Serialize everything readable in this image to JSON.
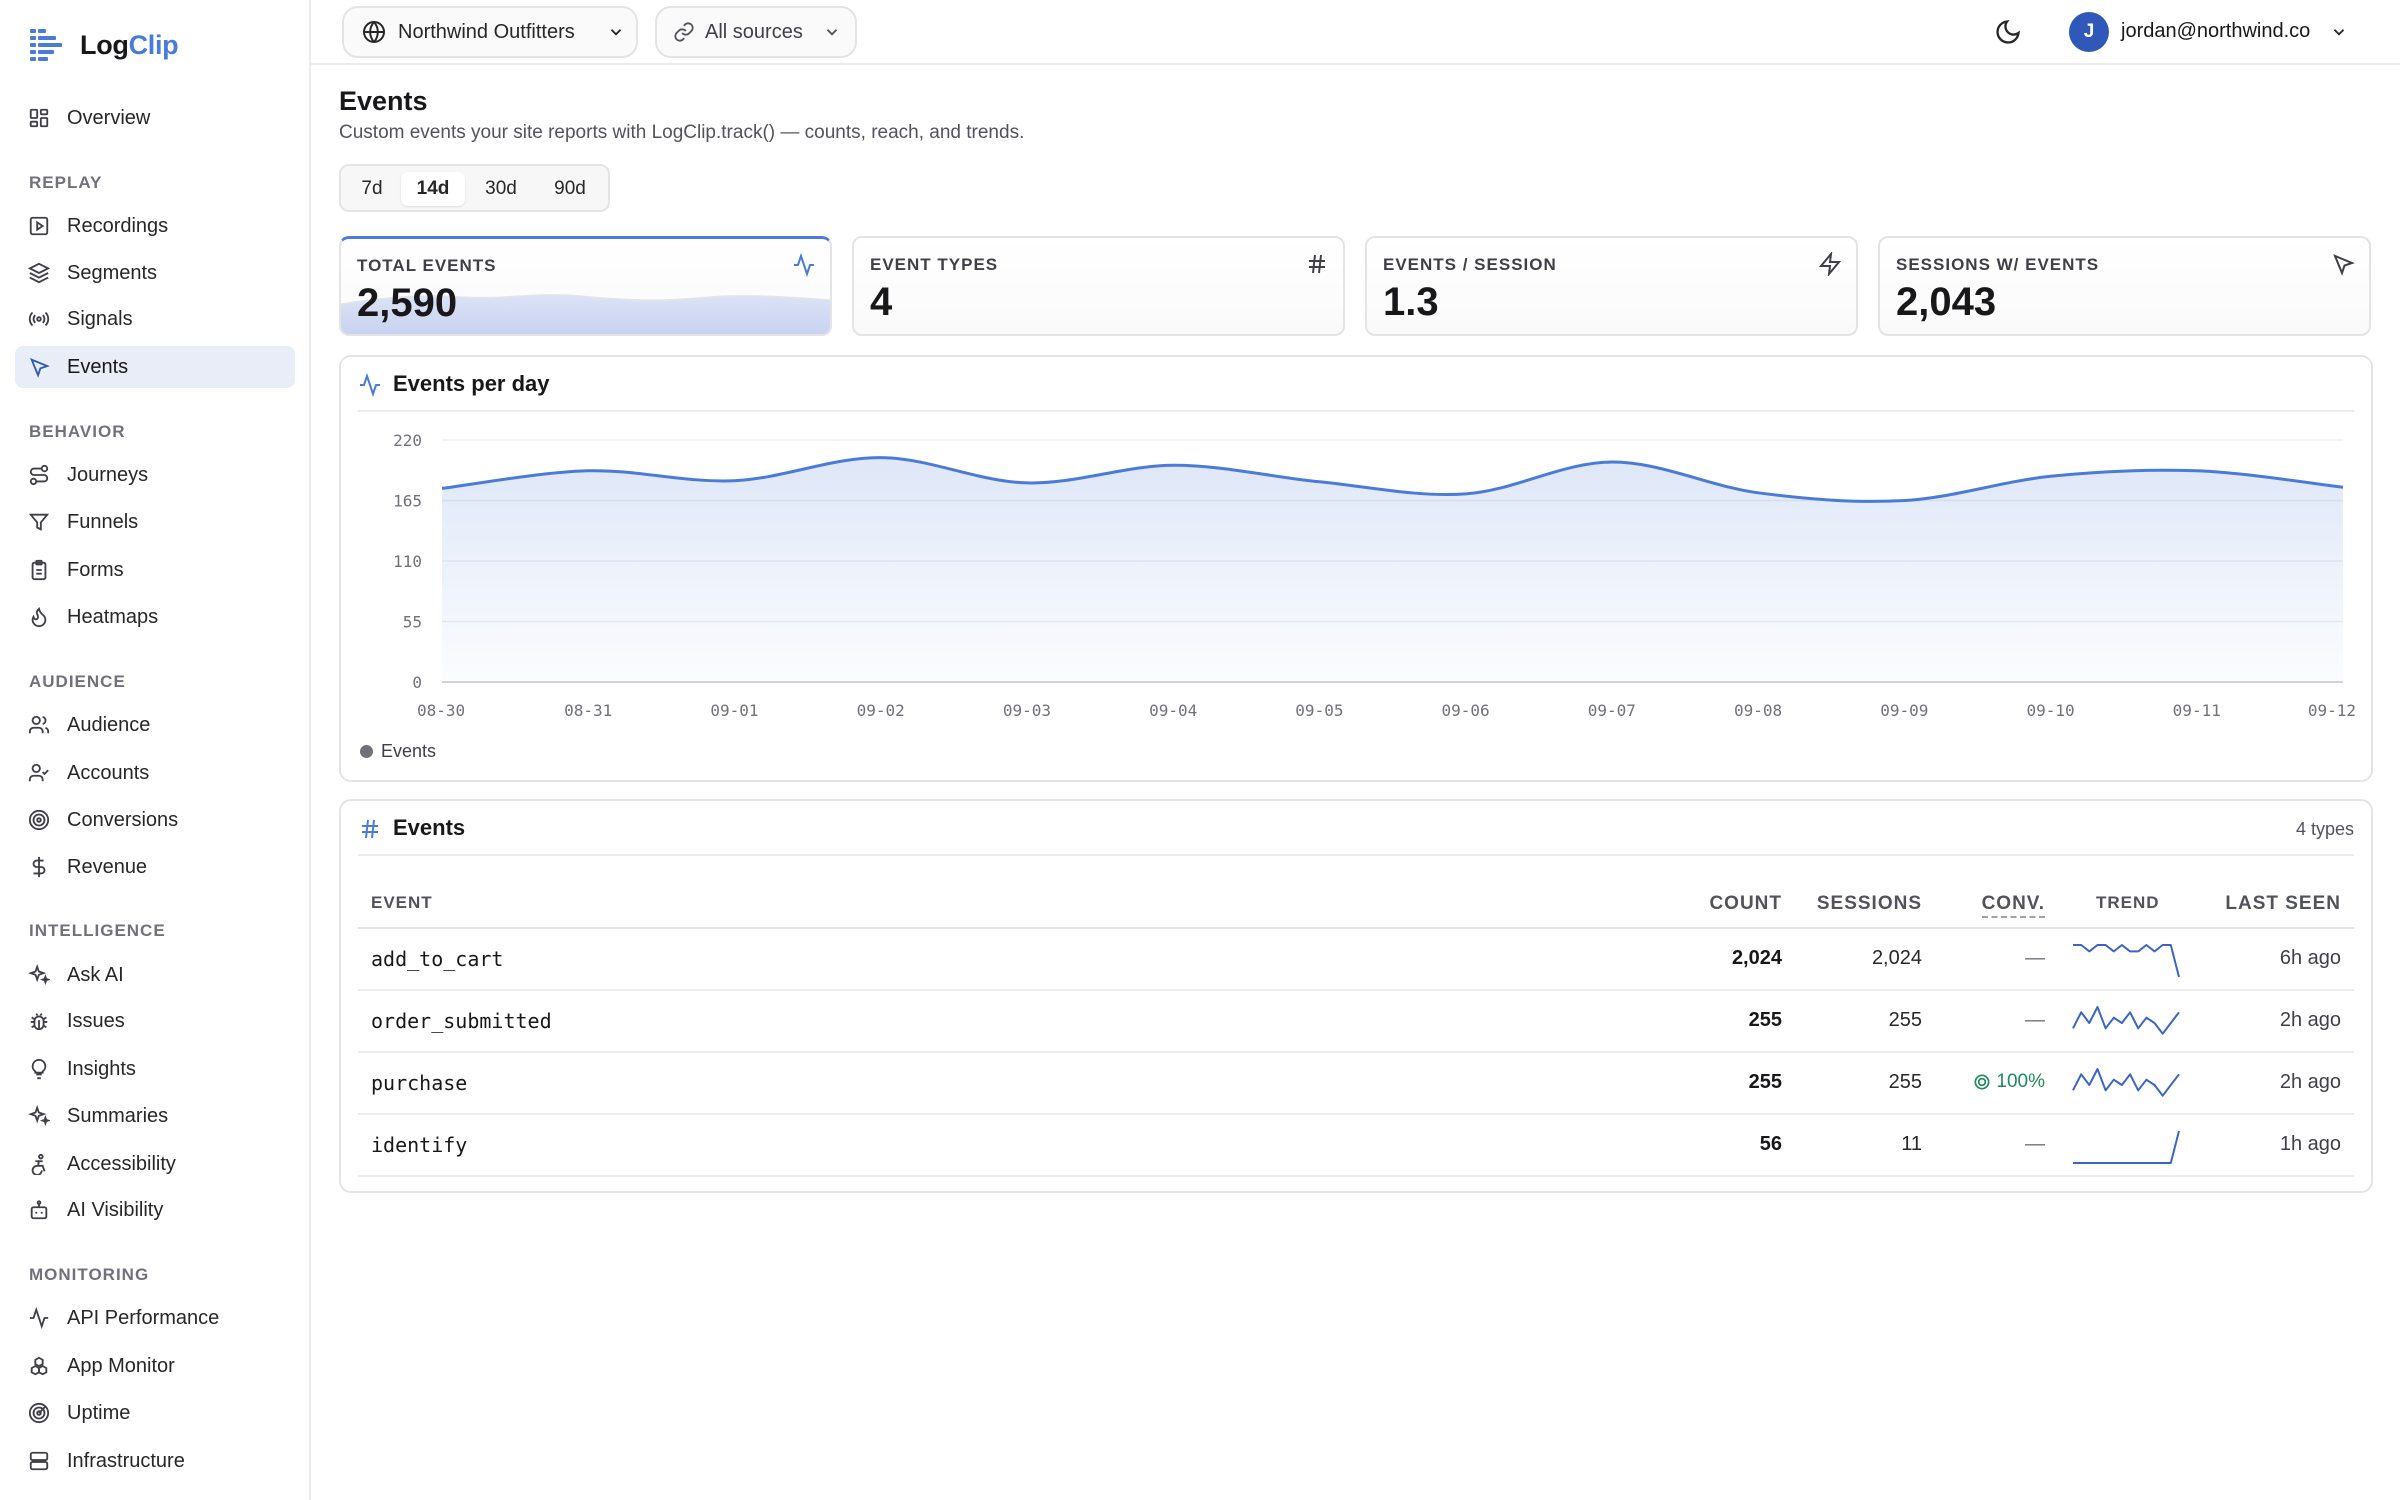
{
  "app": {
    "name_part1": "Log",
    "name_part2": "Clip",
    "accent": "#4a7bd9"
  },
  "sidebar": {
    "top_item": {
      "label": "Overview",
      "icon": "grid-icon"
    },
    "sections": [
      {
        "title": "REPLAY",
        "items": [
          {
            "label": "Recordings",
            "icon": "play-square-icon"
          },
          {
            "label": "Segments",
            "icon": "layers-icon"
          },
          {
            "label": "Signals",
            "icon": "broadcast-icon"
          },
          {
            "label": "Events",
            "icon": "cursor-icon",
            "active": true
          }
        ]
      },
      {
        "title": "BEHAVIOR",
        "items": [
          {
            "label": "Journeys",
            "icon": "route-icon"
          },
          {
            "label": "Funnels",
            "icon": "funnel-icon"
          },
          {
            "label": "Forms",
            "icon": "clipboard-icon"
          },
          {
            "label": "Heatmaps",
            "icon": "flame-icon"
          }
        ]
      },
      {
        "title": "AUDIENCE",
        "items": [
          {
            "label": "Audience",
            "icon": "users-icon"
          },
          {
            "label": "Accounts",
            "icon": "user-check-icon"
          },
          {
            "label": "Conversions",
            "icon": "target-icon"
          },
          {
            "label": "Revenue",
            "icon": "dollar-icon"
          }
        ]
      },
      {
        "title": "INTELLIGENCE",
        "items": [
          {
            "label": "Ask AI",
            "icon": "sparkles-icon"
          },
          {
            "label": "Issues",
            "icon": "bug-icon"
          },
          {
            "label": "Insights",
            "icon": "lightbulb-icon"
          },
          {
            "label": "Summaries",
            "icon": "sparkles-icon"
          },
          {
            "label": "Accessibility",
            "icon": "accessibility-icon"
          },
          {
            "label": "AI Visibility",
            "icon": "bot-icon"
          }
        ]
      },
      {
        "title": "MONITORING",
        "items": [
          {
            "label": "API Performance",
            "icon": "activity-icon"
          },
          {
            "label": "App Monitor",
            "icon": "boxes-icon"
          },
          {
            "label": "Uptime",
            "icon": "radar-icon"
          },
          {
            "label": "Infrastructure",
            "icon": "server-icon"
          }
        ]
      }
    ]
  },
  "topbar": {
    "workspace": "Northwind Outfitters",
    "source": "All sources",
    "user_initial": "J",
    "user_email": "jordan@northwind.co"
  },
  "page": {
    "title": "Events",
    "subtitle": "Custom events your site reports with LogClip.track() — counts, reach, and trends.",
    "ranges": [
      "7d",
      "14d",
      "30d",
      "90d"
    ],
    "active_range": "14d"
  },
  "stats": [
    {
      "label": "TOTAL EVENTS",
      "value": "2,590",
      "icon": "activity-icon"
    },
    {
      "label": "EVENT TYPES",
      "value": "4",
      "icon": "hash-icon"
    },
    {
      "label": "EVENTS / SESSION",
      "value": "1.3",
      "icon": "zap-icon"
    },
    {
      "label": "SESSIONS W/ EVENTS",
      "value": "2,043",
      "icon": "cursor-icon"
    }
  ],
  "chart_card": {
    "title": "Events per day"
  },
  "chart_data": {
    "type": "area",
    "title": "Events per day",
    "x": [
      "08-30",
      "08-31",
      "09-01",
      "09-02",
      "09-03",
      "09-04",
      "09-05",
      "09-06",
      "09-07",
      "09-08",
      "09-09",
      "09-10",
      "09-11",
      "09-12"
    ],
    "series": [
      {
        "name": "Events",
        "values": [
          176,
          192,
          183,
          204,
          181,
          197,
          182,
          171,
          200,
          172,
          165,
          187,
          192,
          177
        ]
      }
    ],
    "y_ticks": [
      "220",
      "165",
      "110",
      "55",
      "0"
    ],
    "ylim": [
      0,
      220
    ],
    "grid": true,
    "legend": "bottom-left",
    "color": "#4a7bd9"
  },
  "table": {
    "title": "Events",
    "count_label": "4 types",
    "columns": {
      "event": "EVENT",
      "count": "COUNT",
      "sessions": "SESSIONS",
      "conv": "CONV.",
      "trend": "TREND",
      "last_seen": "LAST SEEN"
    },
    "rows": [
      {
        "event": "add_to_cart",
        "count": "2,024",
        "sessions": "2,024",
        "conv": "—",
        "last_seen": "6h ago",
        "trend": [
          5,
          5,
          4,
          5,
          5,
          4,
          5,
          4,
          4,
          5,
          4,
          5,
          5,
          0
        ]
      },
      {
        "event": "order_submitted",
        "count": "255",
        "sessions": "255",
        "conv": "—",
        "last_seen": "2h ago",
        "trend": [
          2,
          5,
          3,
          6,
          2,
          4,
          3,
          5,
          2,
          4,
          3,
          1,
          3,
          5
        ]
      },
      {
        "event": "purchase",
        "count": "255",
        "sessions": "255",
        "conv": "100%",
        "last_seen": "2h ago",
        "trend": [
          2,
          5,
          3,
          6,
          2,
          4,
          3,
          5,
          2,
          4,
          3,
          1,
          3,
          5
        ]
      },
      {
        "event": "identify",
        "count": "56",
        "sessions": "11",
        "conv": "—",
        "last_seen": "1h ago",
        "trend": [
          0,
          0,
          0,
          0,
          0,
          0,
          0,
          0,
          0,
          0,
          0,
          0,
          0,
          8
        ]
      }
    ]
  },
  "colors": {
    "conv_good": "#1f8a5b",
    "active_nav": "#e9edf8",
    "avatar": "#2f58b8"
  }
}
